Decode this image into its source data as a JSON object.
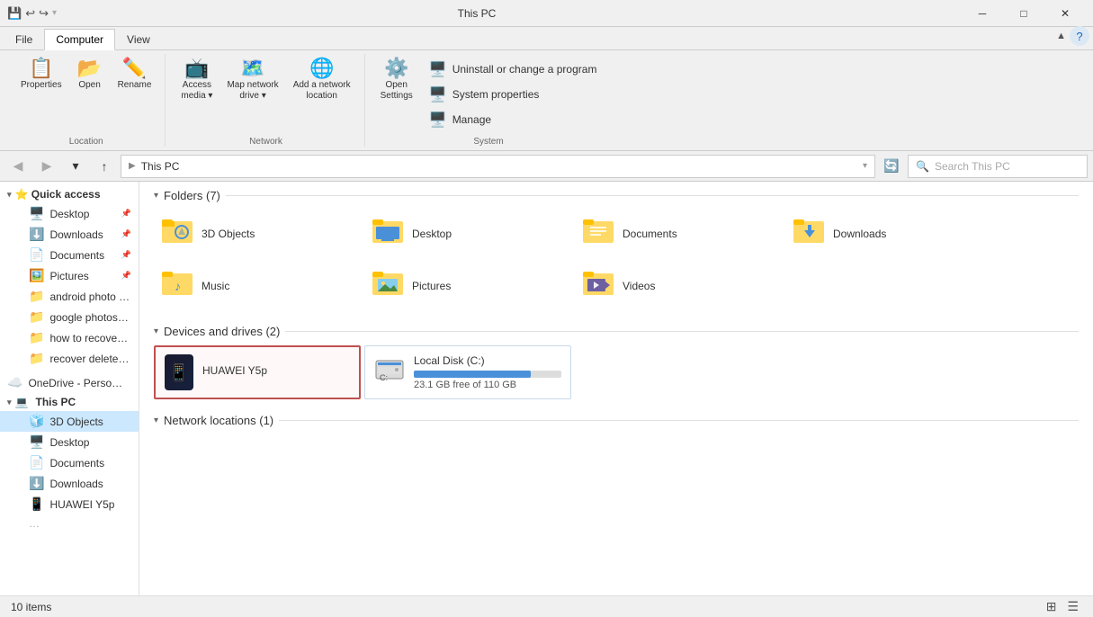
{
  "titleBar": {
    "title": "This PC",
    "quickAccessIcons": [
      "save-icon",
      "undo-icon",
      "redo-icon"
    ],
    "windowControls": {
      "minimize": "─",
      "maximize": "□",
      "close": "✕"
    }
  },
  "ribbon": {
    "tabs": [
      "File",
      "Computer",
      "View"
    ],
    "activeTab": "Computer",
    "groups": {
      "location": {
        "label": "Location",
        "buttons": [
          {
            "id": "properties",
            "label": "Properties",
            "icon": "📋"
          },
          {
            "id": "open",
            "label": "Open",
            "icon": "📂"
          },
          {
            "id": "rename",
            "label": "Rename",
            "icon": "✏️"
          }
        ]
      },
      "network": {
        "label": "Network",
        "buttons": [
          {
            "id": "access-media",
            "label": "Access\nmedia ▾",
            "icon": "📺"
          },
          {
            "id": "map-network",
            "label": "Map network\ndrive ▾",
            "icon": "🗺️"
          },
          {
            "id": "add-network",
            "label": "Add a network\nlocation",
            "icon": "🌐"
          }
        ]
      },
      "system": {
        "label": "System",
        "items": [
          {
            "id": "uninstall",
            "label": "Uninstall or change a program",
            "icon": "🖥️"
          },
          {
            "id": "system-props",
            "label": "System properties",
            "icon": "🖥️"
          },
          {
            "id": "manage",
            "label": "Manage",
            "icon": "🖥️"
          }
        ],
        "openSettings": {
          "label": "Open\nSettings",
          "icon": "⚙️"
        }
      }
    }
  },
  "addressBar": {
    "backEnabled": false,
    "forwardEnabled": false,
    "upEnabled": true,
    "path": [
      "This PC"
    ],
    "placeholder": "Search This PC",
    "refreshIcon": "🔄"
  },
  "sidebar": {
    "quickAccess": {
      "label": "Quick access",
      "items": [
        {
          "id": "desktop",
          "label": "Desktop",
          "icon": "🖥️",
          "pinned": true
        },
        {
          "id": "downloads",
          "label": "Downloads",
          "icon": "⬇️",
          "pinned": true
        },
        {
          "id": "documents",
          "label": "Documents",
          "icon": "📄",
          "pinned": true
        },
        {
          "id": "pictures",
          "label": "Pictures",
          "icon": "🖼️",
          "pinned": true
        },
        {
          "id": "android-photo",
          "label": "android photo r…",
          "icon": "📁",
          "pinned": false
        },
        {
          "id": "google-photos",
          "label": "google photos r…",
          "icon": "📁",
          "pinned": false
        },
        {
          "id": "how-to-recover",
          "label": "how to recover e…",
          "icon": "📁",
          "pinned": false
        },
        {
          "id": "recover-deleted",
          "label": "recover deleted p…",
          "icon": "📁",
          "pinned": false
        }
      ]
    },
    "onedrive": {
      "label": "OneDrive - Person…",
      "icon": "☁️"
    },
    "thisPC": {
      "label": "This PC",
      "icon": "💻",
      "active": true,
      "items": [
        {
          "id": "3d-objects",
          "label": "3D Objects",
          "icon": "🧊"
        },
        {
          "id": "desktop",
          "label": "Desktop",
          "icon": "🖥️"
        },
        {
          "id": "documents",
          "label": "Documents",
          "icon": "📄"
        },
        {
          "id": "downloads",
          "label": "Downloads",
          "icon": "⬇️"
        },
        {
          "id": "huawei",
          "label": "HUAWEI Y5p",
          "icon": "📱"
        }
      ]
    }
  },
  "content": {
    "folders": {
      "sectionLabel": "Folders (7)",
      "items": [
        {
          "id": "3d-objects",
          "label": "3D Objects",
          "iconColor": "#5ba0d0",
          "iconChar": "🧊"
        },
        {
          "id": "desktop",
          "label": "Desktop",
          "iconColor": "#4a90d9",
          "iconChar": "🖥️"
        },
        {
          "id": "documents",
          "label": "Documents",
          "iconColor": "#8b7355",
          "iconChar": "📄"
        },
        {
          "id": "downloads",
          "label": "Downloads",
          "iconColor": "#4a90d9",
          "iconChar": "⬇️"
        },
        {
          "id": "music",
          "label": "Music",
          "iconColor": "#4a90d0",
          "iconChar": "🎵"
        },
        {
          "id": "pictures",
          "label": "Pictures",
          "iconColor": "#4a90d9",
          "iconChar": "🖼️"
        },
        {
          "id": "videos",
          "label": "Videos",
          "iconColor": "#6e5fa0",
          "iconChar": "🎬"
        }
      ]
    },
    "devices": {
      "sectionLabel": "Devices and drives (2)",
      "items": [
        {
          "id": "huawei",
          "label": "HUAWEI Y5p",
          "type": "phone",
          "selected": true
        },
        {
          "id": "local-disk",
          "label": "Local Disk (C:)",
          "type": "disk",
          "freeSpace": "23.1 GB free of 110 GB",
          "usedPercent": 79
        }
      ]
    },
    "network": {
      "sectionLabel": "Network locations (1)",
      "items": []
    }
  },
  "statusBar": {
    "itemCount": "10 items"
  }
}
